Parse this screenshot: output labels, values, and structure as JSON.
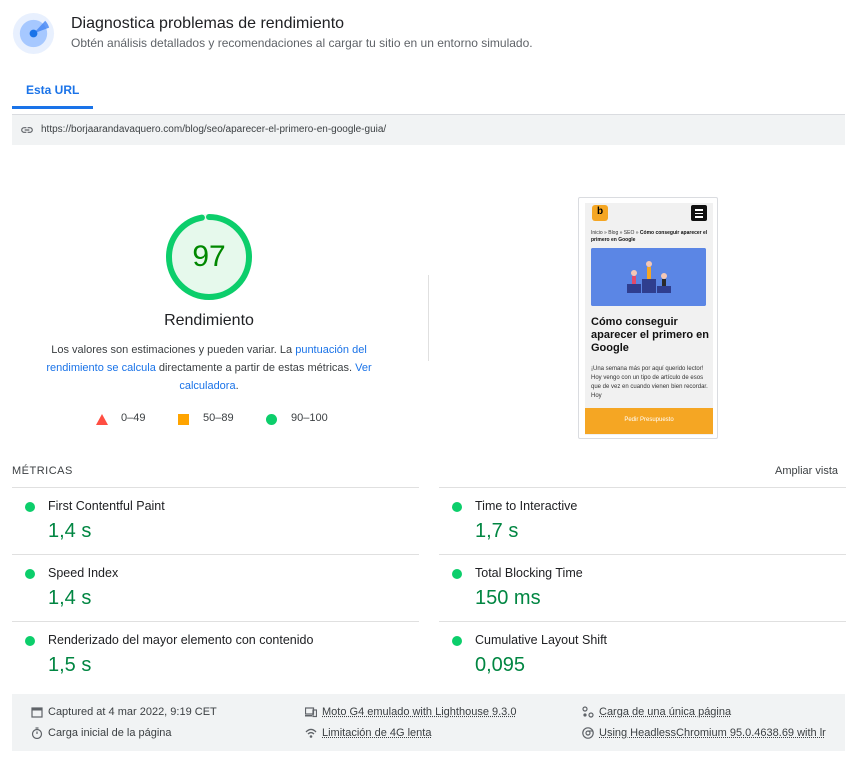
{
  "header": {
    "title": "Diagnostica problemas de rendimiento",
    "subtitle": "Obtén análisis detallados y recomendaciones al cargar tu sitio en un entorno simulado."
  },
  "tabs": [
    {
      "label": "Esta URL",
      "active": true
    }
  ],
  "url": "https://borjaarandavaquero.com/blog/seo/aparecer-el-primero-en-google-guia/",
  "score": {
    "value": 97,
    "fraction": 0.97,
    "label": "Rendimiento",
    "note_part1": "Los valores son estimaciones y pueden variar. La ",
    "note_link1": "puntuación del rendimiento se calcula",
    "note_part2": " directamente a partir de estas métricas. ",
    "note_link2": "Ver calculadora",
    "note_end": "."
  },
  "legend": [
    {
      "label": "0–49",
      "shape": "triangle",
      "color": "#ff4e42"
    },
    {
      "label": "50–89",
      "shape": "square",
      "color": "#ffa400"
    },
    {
      "label": "90–100",
      "shape": "circle",
      "color": "#0cce6b"
    }
  ],
  "screenshot": {
    "logo": "b",
    "breadcrumb_plain": "Inicio » Blog » SEO » ",
    "breadcrumb_bold": "Cómo conseguir aparecer el primero en Google",
    "heading": "Cómo conseguir aparecer el primero en Google",
    "body": "¡Una semana más por aquí querido lector! Hoy vengo con un tipo de artículo de esos que de vez en cuando vienen bien recordar. Hoy",
    "cta": "Pedir Presupuesto"
  },
  "metrics_section": {
    "title": "MÉTRICAS",
    "expand_label": "Ampliar vista"
  },
  "metrics": [
    {
      "name": "First Contentful Paint",
      "value": "1,4 s"
    },
    {
      "name": "Time to Interactive",
      "value": "1,7 s"
    },
    {
      "name": "Speed Index",
      "value": "1,4 s"
    },
    {
      "name": "Total Blocking Time",
      "value": "150 ms"
    },
    {
      "name": "Renderizado del mayor elemento con contenido",
      "value": "1,5 s"
    },
    {
      "name": "Cumulative Layout Shift",
      "value": "0,095"
    }
  ],
  "footer": {
    "captured": "Captured at 4 mar 2022, 9:19 CET",
    "device": "Moto G4 emulado with Lighthouse 9.3.0",
    "page_load": "Carga de una única página",
    "initial_load": "Carga inicial de la página",
    "throttling": "Limitación de 4G lenta",
    "browser": "Using HeadlessChromium 95.0.4638.69 with lr"
  },
  "colors": {
    "pass": "#0cce6b",
    "pass_text": "#008800",
    "accent": "#1a73e8"
  }
}
